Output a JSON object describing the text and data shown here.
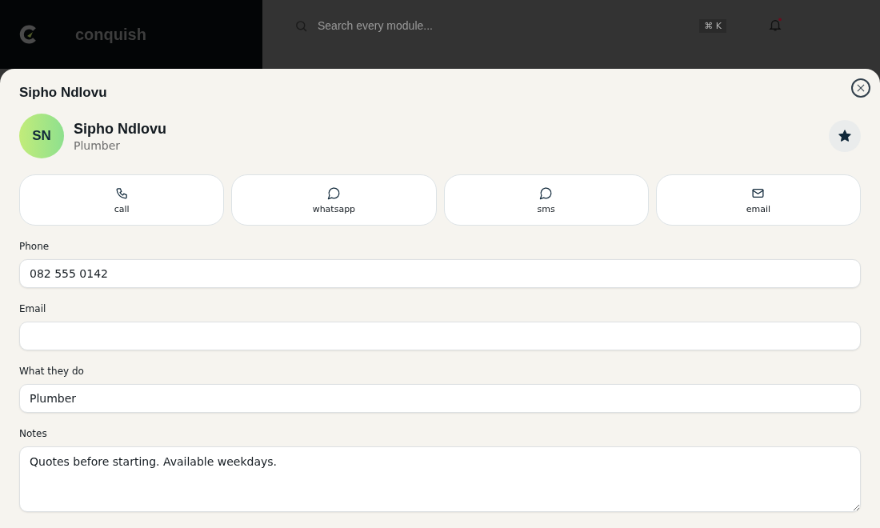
{
  "app_header": {
    "brand": "conquish",
    "search": {
      "placeholder": "Search every module..."
    },
    "shortcut": "⌘ K",
    "notifications_unread": true
  },
  "sheet": {
    "title": "Sipho Ndlovu",
    "contact": {
      "initials": "SN",
      "name": "Sipho Ndlovu",
      "role": "Plumber",
      "favorite": true
    },
    "actions": [
      {
        "kind": "call",
        "label": "call"
      },
      {
        "kind": "whatsapp",
        "label": "whatsapp"
      },
      {
        "kind": "sms",
        "label": "sms"
      },
      {
        "kind": "email",
        "label": "email"
      }
    ],
    "fields": [
      {
        "kind": "input",
        "label": "Phone",
        "value": "082 555 0142"
      },
      {
        "kind": "input",
        "label": "Email"
      },
      {
        "kind": "input",
        "label": "What they do",
        "value": "Plumber"
      },
      {
        "kind": "textarea",
        "label": "Notes",
        "value": "Quotes before starting. Available weekdays."
      }
    ]
  }
}
